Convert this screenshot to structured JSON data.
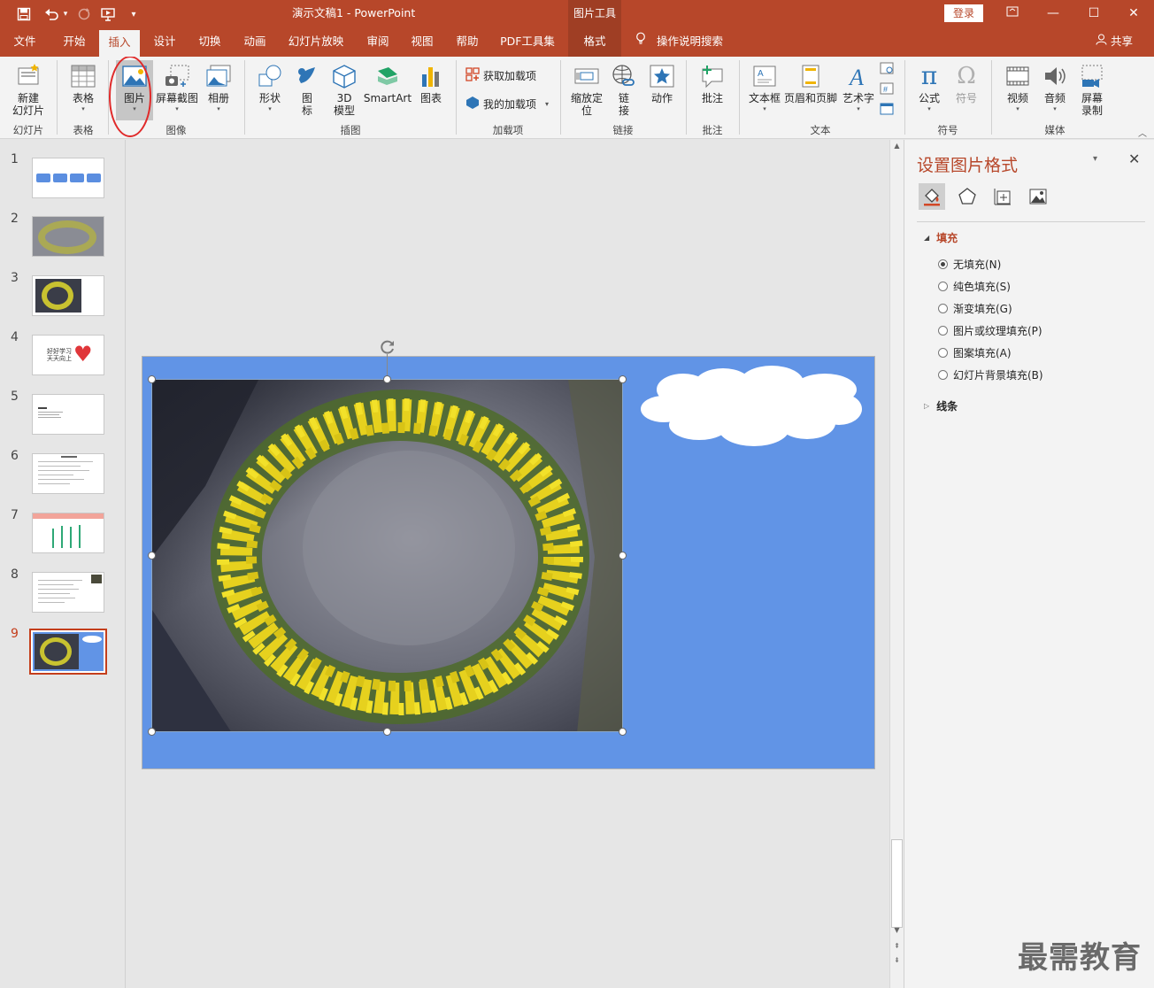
{
  "app": {
    "title": "演示文稿1  -  PowerPoint",
    "context_tab": "图片工具",
    "login": "登录",
    "share": "共享"
  },
  "tabs": [
    {
      "label": "文件"
    },
    {
      "label": "开始"
    },
    {
      "label": "插入"
    },
    {
      "label": "设计"
    },
    {
      "label": "切换"
    },
    {
      "label": "动画"
    },
    {
      "label": "幻灯片放映"
    },
    {
      "label": "审阅"
    },
    {
      "label": "视图"
    },
    {
      "label": "帮助"
    },
    {
      "label": "PDF工具集"
    },
    {
      "label": "格式"
    }
  ],
  "search_label": "操作说明搜索",
  "ribbon": {
    "new_slide": "新建\n幻灯片",
    "table": "表格",
    "picture": "图片",
    "screenshot": "屏幕截图",
    "album": "相册",
    "shapes": "形状",
    "icons": "图\n标",
    "model3d": "3D\n模型",
    "smartart": "SmartArt",
    "chart": "图表",
    "get_addins": "获取加载项",
    "my_addins": "我的加载项",
    "zoom": "缩放定\n位",
    "link": "链\n接",
    "action": "动作",
    "comment": "批注",
    "textbox": "文本框",
    "headerfooter": "页眉和页脚",
    "wordart": "艺术字",
    "equation": "公式",
    "symbol": "符号",
    "video": "视频",
    "audio": "音频",
    "screenrec": "屏幕\n录制",
    "groups": {
      "slides": "幻灯片",
      "tables": "表格",
      "images": "图像",
      "illustrations": "插图",
      "addins": "加载项",
      "links": "链接",
      "comments": "批注",
      "text": "文本",
      "symbols": "符号",
      "media": "媒体"
    }
  },
  "thumbnails": [
    {
      "num": "1"
    },
    {
      "num": "2"
    },
    {
      "num": "3"
    },
    {
      "num": "4",
      "text": "好好学习\n天天向上"
    },
    {
      "num": "5"
    },
    {
      "num": "6"
    },
    {
      "num": "7"
    },
    {
      "num": "8"
    },
    {
      "num": "9",
      "selected": true
    }
  ],
  "pane": {
    "title": "设置图片格式",
    "fill_section": "填充",
    "line_section": "线条",
    "options": [
      {
        "label": "无填充(N)",
        "checked": true
      },
      {
        "label": "纯色填充(S)",
        "checked": false
      },
      {
        "label": "渐变填充(G)",
        "checked": false
      },
      {
        "label": "图片或纹理填充(P)",
        "checked": false
      },
      {
        "label": "图案填充(A)",
        "checked": false
      },
      {
        "label": "幻灯片背景填充(B)",
        "checked": false
      }
    ]
  },
  "watermark": "最需教育"
}
